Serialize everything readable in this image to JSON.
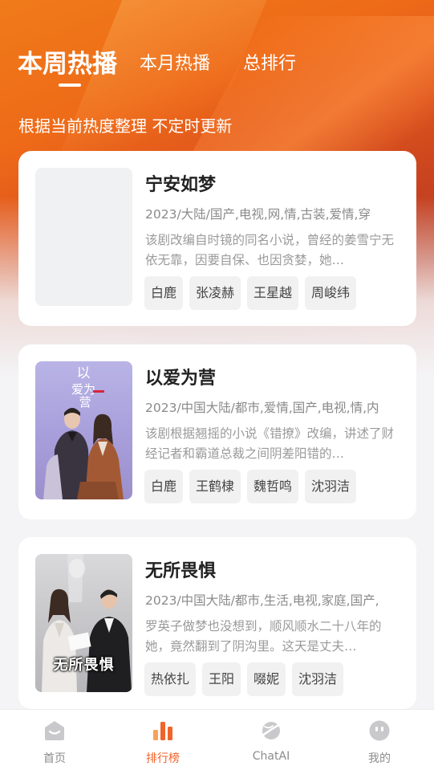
{
  "tabs": [
    {
      "label": "本周热播",
      "active": true
    },
    {
      "label": "本月热播",
      "active": false
    },
    {
      "label": "总排行",
      "active": false
    }
  ],
  "subtitle": "根据当前热度整理 不定时更新",
  "cards": [
    {
      "title": "宁安如梦",
      "meta": "2023/大陆/国产,电视,网,情,古装,爱情,穿",
      "desc": "该剧改编自时镜的同名小说，曾经的姜雪宁无依无靠，因要自保、也因贪婪，她…",
      "tags": [
        "白鹿",
        "张凌赫",
        "王星越",
        "周峻纬"
      ],
      "poster": "empty"
    },
    {
      "title": "以爱为营",
      "meta": "2023/中国大陆/都市,爱情,国产,电视,情,内",
      "desc": "该剧根据翘摇的小说《错撩》改编，讲述了财经记者和霸道总裁之间阴差阳错的…",
      "tags": [
        "白鹿",
        "王鹤棣",
        "魏哲鸣",
        "沈羽洁"
      ],
      "poster": "purple",
      "poster_text": "以爱为营"
    },
    {
      "title": "无所畏惧",
      "meta": "2023/中国大陆/都市,生活,电视,家庭,国产,",
      "desc": "罗英子做梦也没想到，顺风顺水二十八年的她，竟然翻到了阴沟里。这天是丈夫…",
      "tags": [
        "热依扎",
        "王阳",
        "啜妮",
        "沈羽洁"
      ],
      "poster": "gray",
      "poster_text": "无所畏惧"
    }
  ],
  "nav": [
    {
      "label": "首页",
      "icon": "home-icon",
      "active": false
    },
    {
      "label": "排行榜",
      "icon": "chart-bar-icon",
      "active": true
    },
    {
      "label": "ChatAI",
      "icon": "planet-icon",
      "active": false
    },
    {
      "label": "我的",
      "icon": "smile-face-icon",
      "active": false
    }
  ],
  "colors": {
    "accent": "#f0642c",
    "hero_orange": "#ee6a18",
    "hero_red": "#b83a22"
  }
}
